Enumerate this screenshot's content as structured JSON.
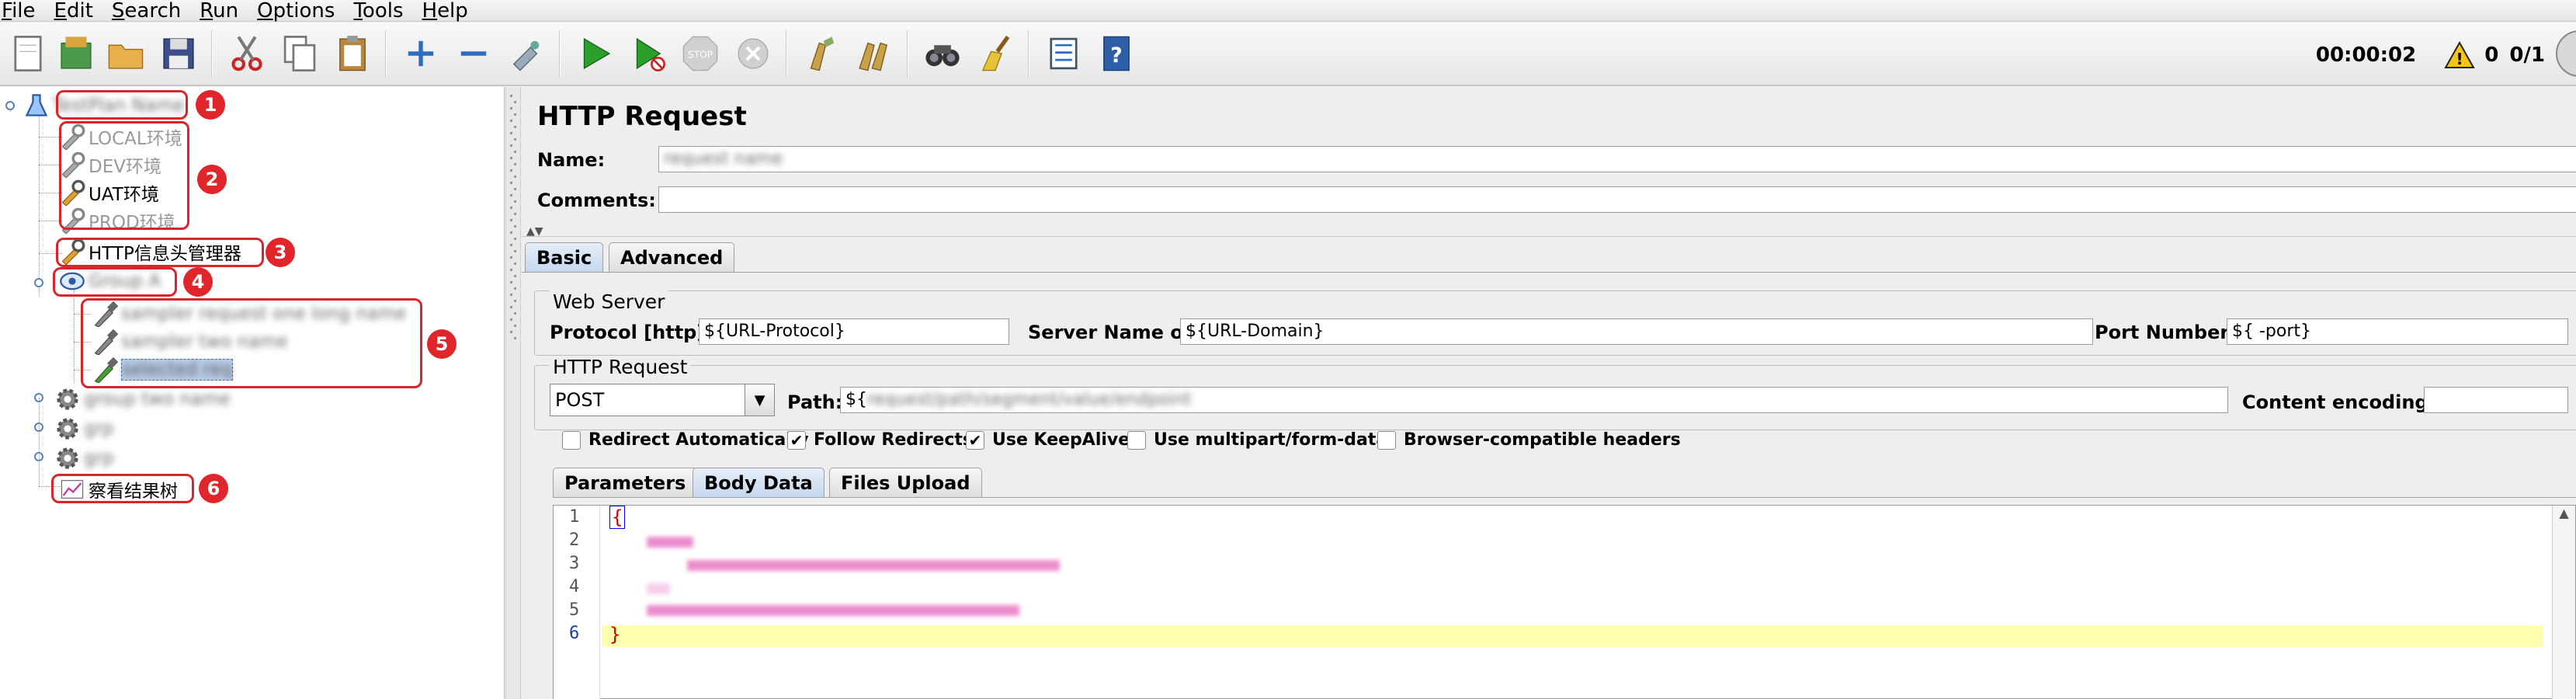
{
  "menu": [
    "File",
    "Edit",
    "Search",
    "Run",
    "Options",
    "Tools",
    "Help"
  ],
  "toolbar": {
    "buttons": [
      "new-icon",
      "templates-icon",
      "open-icon",
      "save-icon",
      "cut-icon",
      "copy-icon",
      "paste-icon",
      "expand-icon",
      "collapse-icon",
      "toggle-icon",
      "start-icon",
      "start-no-pause-icon",
      "stop-icon",
      "shutdown-icon",
      "clear-icon",
      "clear-all-icon",
      "search-icon",
      "reset-search-icon",
      "function-helper-icon",
      "help-icon"
    ],
    "timer": "00:00:02",
    "warn_count": "0",
    "threads": "0/1"
  },
  "tree": {
    "items": [
      {
        "label": "LOCAL环境"
      },
      {
        "label": "DEV环境"
      },
      {
        "label": "UAT环境"
      },
      {
        "label": "PROD环境"
      },
      {
        "label": "HTTP信息头管理器"
      },
      {
        "label": "察看结果树"
      }
    ],
    "badges": [
      "1",
      "2",
      "3",
      "4",
      "5",
      "6"
    ]
  },
  "panel": {
    "title": "HTTP Request",
    "name_label": "Name:",
    "comments_label": "Comments:",
    "comments_value": "",
    "tabs": [
      "Basic",
      "Advanced"
    ],
    "web_server": {
      "legend": "Web Server",
      "protocol_label": "Protocol [http]:",
      "protocol_value": "${URL-Protocol}",
      "server_label": "Server Name or IP:",
      "server_value": "${URL-Domain}",
      "port_label": "Port Number:",
      "port_value": "${ -port}"
    },
    "http_request": {
      "legend": "HTTP Request",
      "method": "POST",
      "path_label": "Path:",
      "path_value": "${",
      "encoding_label": "Content encoding:",
      "encoding_value": ""
    },
    "checkboxes": [
      {
        "label": "Redirect Automatically",
        "checked": false
      },
      {
        "label": "Follow Redirects",
        "checked": true
      },
      {
        "label": "Use KeepAlive",
        "checked": true
      },
      {
        "label": "Use multipart/form-data",
        "checked": false
      },
      {
        "label": "Browser-compatible headers",
        "checked": false
      }
    ],
    "body_tabs": [
      "Parameters",
      "Body Data",
      "Files Upload"
    ],
    "editor": {
      "line_numbers": [
        "1",
        "2",
        "3",
        "4",
        "5",
        "6"
      ],
      "first_line": "{",
      "last_line": "}"
    }
  },
  "colors": {
    "badge": "#e0252b",
    "selection": "#b8cbe6",
    "highlight_line": "#ffffb0"
  }
}
